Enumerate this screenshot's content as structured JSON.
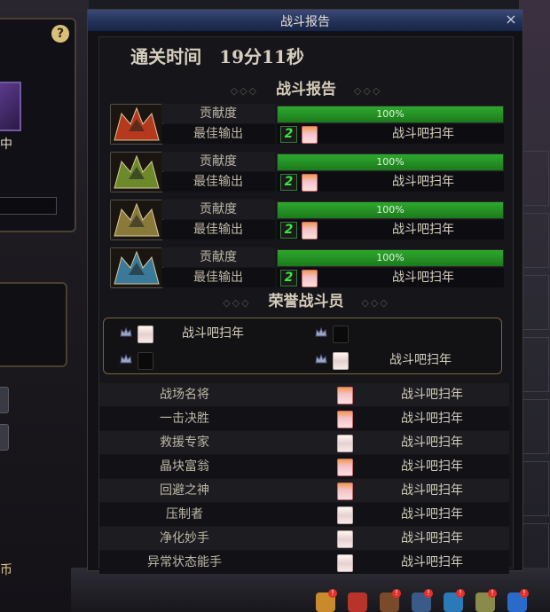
{
  "window": {
    "title": "战斗报告",
    "close": "×"
  },
  "clear_time": "通关时间　19分11秒",
  "sections": {
    "report": "战斗报告",
    "honor": "荣誉战斗员",
    "deco_left": "◇◇◇",
    "deco_right": "◇◇◇"
  },
  "left_panel": {
    "help": "?",
    "status_text": "中",
    "currency_text": "币"
  },
  "bosses": [
    {
      "contribution_label": "贡献度",
      "contribution_value": 100,
      "contribution_text": "100%",
      "best_label": "最佳输出",
      "rank": "2",
      "best_player": "战斗吧扫年",
      "portrait_color": "#b5391c"
    },
    {
      "contribution_label": "贡献度",
      "contribution_value": 100,
      "contribution_text": "100%",
      "best_label": "最佳输出",
      "rank": "2",
      "best_player": "战斗吧扫年",
      "portrait_color": "#6d8a2a"
    },
    {
      "contribution_label": "贡献度",
      "contribution_value": 100,
      "contribution_text": "100%",
      "best_label": "最佳输出",
      "rank": "2",
      "best_player": "战斗吧扫年",
      "portrait_color": "#8a7a3a"
    },
    {
      "contribution_label": "贡献度",
      "contribution_value": 100,
      "contribution_text": "100%",
      "best_label": "最佳输出",
      "rank": "2",
      "best_player": "战斗吧扫年",
      "portrait_color": "#3a7a98"
    }
  ],
  "honor": [
    {
      "name": "战斗吧扫年"
    },
    {
      "name": ""
    },
    {
      "name": ""
    },
    {
      "name": "战斗吧扫年"
    }
  ],
  "awards": [
    {
      "label": "战场名将",
      "player": "战斗吧扫年",
      "icon": "pink"
    },
    {
      "label": "一击决胜",
      "player": "战斗吧扫年",
      "icon": "pink"
    },
    {
      "label": "救援专家",
      "player": "战斗吧扫年",
      "icon": "white"
    },
    {
      "label": "晶块富翁",
      "player": "战斗吧扫年",
      "icon": "pink"
    },
    {
      "label": "回避之神",
      "player": "战斗吧扫年",
      "icon": "pink"
    },
    {
      "label": "压制者",
      "player": "战斗吧扫年",
      "icon": "white"
    },
    {
      "label": "净化妙手",
      "player": "战斗吧扫年",
      "icon": "white"
    },
    {
      "label": "异常状态能手",
      "player": "战斗吧扫年",
      "icon": "white"
    }
  ],
  "toolbar": {
    "badge": "!"
  }
}
